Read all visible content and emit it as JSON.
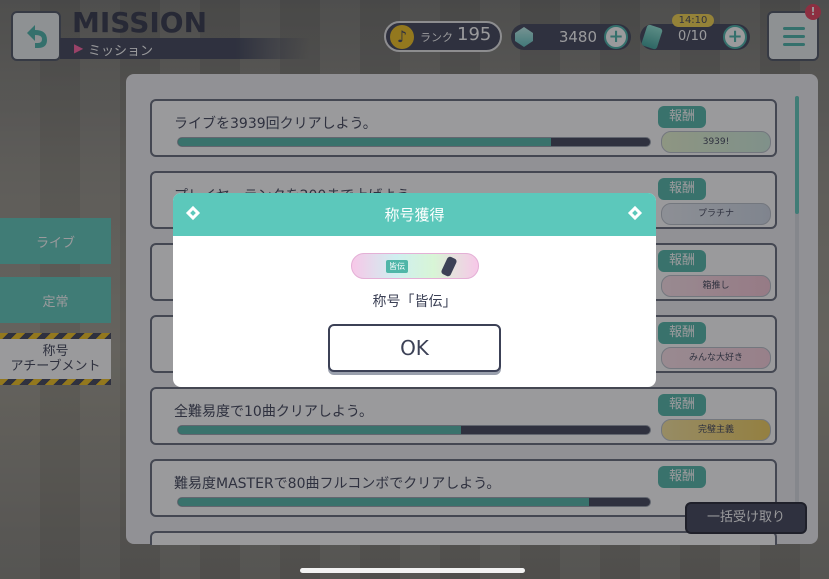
{
  "header": {
    "title": "MISSION",
    "subtitle": "ミッション",
    "rank_label": "ランク",
    "rank_value": "195",
    "crystal_value": "3480",
    "stamina_value": "0/10",
    "stamina_timer": "14:10",
    "notification_badge": "!"
  },
  "sidebar": {
    "items": [
      {
        "label": "ライブ"
      },
      {
        "label": "定常"
      },
      {
        "label": "称号\nアチーブメント"
      }
    ],
    "active_index": 2
  },
  "missions": [
    {
      "text": "ライブを3939回クリアしよう。",
      "reward_tag": "報酬",
      "reward_plate": "3939!",
      "progress": 0.79
    },
    {
      "text": "プレイヤーランクを200まで上げよう。",
      "reward_tag": "報酬",
      "reward_plate": "プラチナ",
      "progress": 0.97
    },
    {
      "text": "",
      "reward_tag": "報酬",
      "reward_plate": "箱推し",
      "progress": 0
    },
    {
      "text": "",
      "reward_tag": "報酬",
      "reward_plate": "みんな大好き",
      "progress": 0
    },
    {
      "text": "全難易度で10曲クリアしよう。",
      "reward_tag": "報酬",
      "reward_plate": "完璧主義",
      "progress": 0.6
    },
    {
      "text": "難易度MASTERで80曲フルコンボでクリアしよう。",
      "reward_tag": "報酬",
      "reward_plate": "",
      "progress": 0.87
    }
  ],
  "bulk_receive_label": "一括受け取り",
  "modal": {
    "title": "称号獲得",
    "plate_label": "皆伝",
    "message": "称号「皆伝」",
    "ok_label": "OK"
  },
  "colors": {
    "accent": "#5cc8bb",
    "dark": "#3c4156",
    "progress_fill": "#4fb6a8"
  }
}
